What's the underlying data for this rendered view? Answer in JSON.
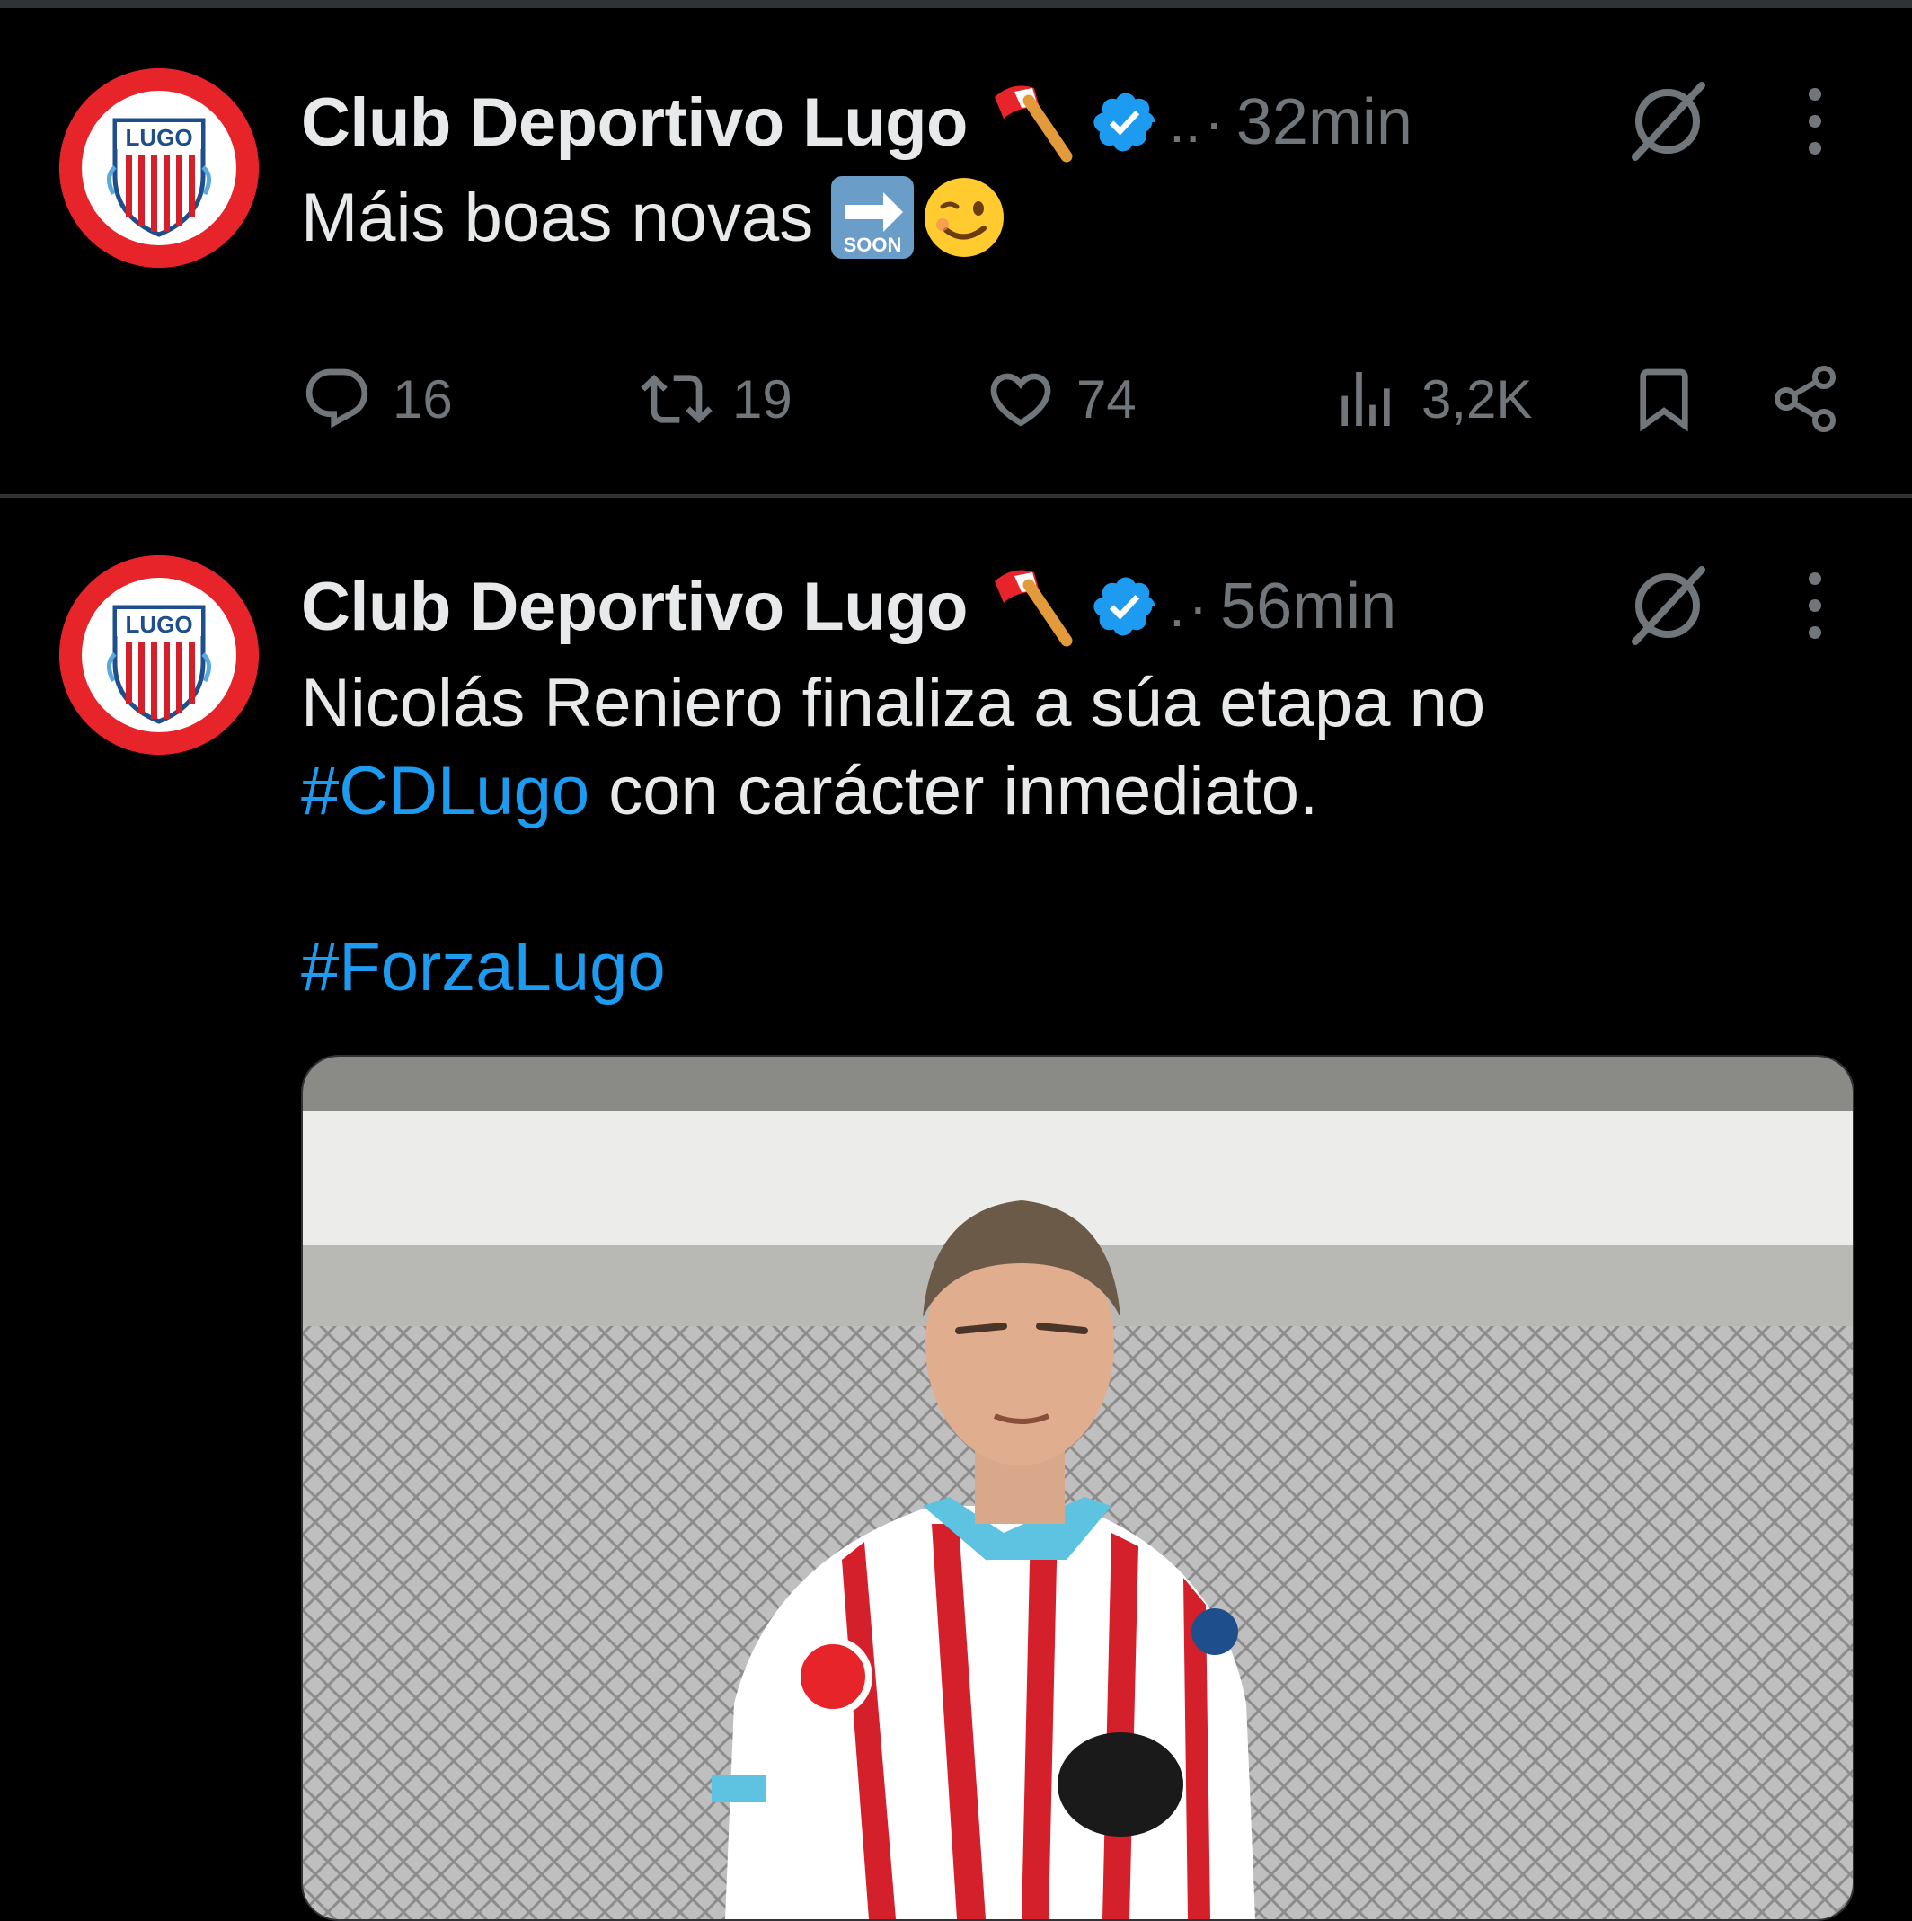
{
  "tweets": [
    {
      "author": "Club Deportivo Lugo",
      "handle_truncated": "..",
      "separator": "·",
      "time": "32min",
      "text": "Máis boas novas",
      "emoji": [
        "soon-arrow-emoji",
        "winking-face-emoji"
      ],
      "stats": {
        "replies": "16",
        "reposts": "19",
        "likes": "74",
        "views": "3,2K"
      }
    },
    {
      "author": "Club Deportivo Lugo",
      "handle_truncated": ".",
      "separator": "·",
      "time": "56min",
      "text_line1": "Nicolás Reniero finaliza a súa etapa no",
      "hashtag1": "#CDLugo",
      "text_line2_rest": " con carácter inmediato.",
      "hashtag2": "#ForzaLugo",
      "media": "photo of a player in a red-and-white striped jersey"
    }
  ],
  "colors": {
    "background": "#000000",
    "text": "#e7e9ea",
    "secondary": "#71767b",
    "link": "#1d9bf0",
    "verified": "#1d9bf0",
    "avatar_ring": "#e8242b"
  },
  "icons": [
    "reply-icon",
    "repost-icon",
    "like-icon",
    "views-icon",
    "bookmark-icon",
    "share-icon",
    "grok-icon",
    "more-icon",
    "verified-badge-icon",
    "axe-emoji"
  ]
}
